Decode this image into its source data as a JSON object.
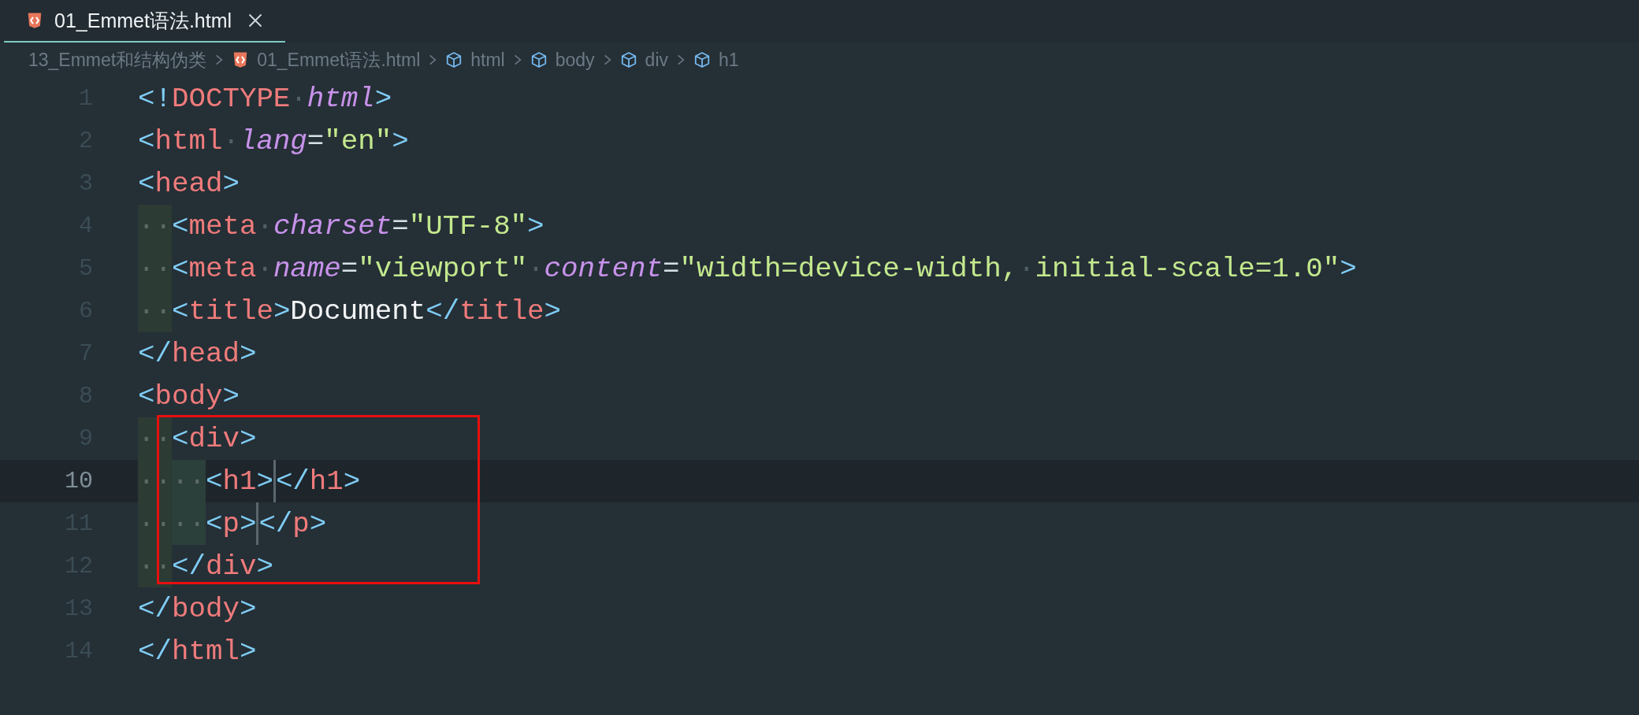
{
  "tab": {
    "label": "01_Emmet语法.html",
    "selected": true
  },
  "breadcrumb": [
    {
      "kind": "folder",
      "label": "13_Emmet和结构伪类"
    },
    {
      "kind": "file",
      "label": "01_Emmet语法.html"
    },
    {
      "kind": "symbol",
      "label": "html"
    },
    {
      "kind": "symbol",
      "label": "body"
    },
    {
      "kind": "symbol",
      "label": "div"
    },
    {
      "kind": "symbol",
      "label": "h1"
    }
  ],
  "lines": [
    {
      "number": "1",
      "current": false,
      "tokens": [
        {
          "kind": "punct",
          "text": "<!"
        },
        {
          "kind": "tag",
          "text": "DOCTYPE"
        },
        {
          "kind": "space",
          "text": "·"
        },
        {
          "kind": "attr",
          "text": "html"
        },
        {
          "kind": "punct",
          "text": ">"
        }
      ]
    },
    {
      "number": "2",
      "current": false,
      "tokens": [
        {
          "kind": "punct",
          "text": "<"
        },
        {
          "kind": "tag",
          "text": "html"
        },
        {
          "kind": "space",
          "text": "·"
        },
        {
          "kind": "attr",
          "text": "lang"
        },
        {
          "kind": "op",
          "text": "="
        },
        {
          "kind": "string",
          "text": "\"en\""
        },
        {
          "kind": "punct",
          "text": ">"
        }
      ]
    },
    {
      "number": "3",
      "current": false,
      "tokens": [
        {
          "kind": "punct",
          "text": "<"
        },
        {
          "kind": "tag",
          "text": "head"
        },
        {
          "kind": "punct",
          "text": ">"
        }
      ]
    },
    {
      "number": "4",
      "current": false,
      "tokens": [
        {
          "kind": "indent",
          "text": "··"
        },
        {
          "kind": "punct",
          "text": "<"
        },
        {
          "kind": "tag",
          "text": "meta"
        },
        {
          "kind": "space",
          "text": "·"
        },
        {
          "kind": "attr",
          "text": "charset"
        },
        {
          "kind": "op",
          "text": "="
        },
        {
          "kind": "string",
          "text": "\"UTF-8\""
        },
        {
          "kind": "punct",
          "text": ">"
        }
      ]
    },
    {
      "number": "5",
      "current": false,
      "tokens": [
        {
          "kind": "indent",
          "text": "··"
        },
        {
          "kind": "punct",
          "text": "<"
        },
        {
          "kind": "tag",
          "text": "meta"
        },
        {
          "kind": "space",
          "text": "·"
        },
        {
          "kind": "attr",
          "text": "name"
        },
        {
          "kind": "op",
          "text": "="
        },
        {
          "kind": "string",
          "text": "\"viewport\""
        },
        {
          "kind": "space",
          "text": "·"
        },
        {
          "kind": "attr",
          "text": "content"
        },
        {
          "kind": "op",
          "text": "="
        },
        {
          "kind": "string",
          "text": "\"width=device-width,"
        },
        {
          "kind": "space",
          "text": "·"
        },
        {
          "kind": "string",
          "text": "initial-scale=1.0\""
        },
        {
          "kind": "punct",
          "text": ">"
        }
      ]
    },
    {
      "number": "6",
      "current": false,
      "tokens": [
        {
          "kind": "indent",
          "text": "··"
        },
        {
          "kind": "punct",
          "text": "<"
        },
        {
          "kind": "tag",
          "text": "title"
        },
        {
          "kind": "punct",
          "text": ">"
        },
        {
          "kind": "text",
          "text": "Document"
        },
        {
          "kind": "punct",
          "text": "</"
        },
        {
          "kind": "tag",
          "text": "title"
        },
        {
          "kind": "punct",
          "text": ">"
        }
      ]
    },
    {
      "number": "7",
      "current": false,
      "tokens": [
        {
          "kind": "punct",
          "text": "</"
        },
        {
          "kind": "tag",
          "text": "head"
        },
        {
          "kind": "punct",
          "text": ">"
        }
      ]
    },
    {
      "number": "8",
      "current": false,
      "tokens": [
        {
          "kind": "punct",
          "text": "<"
        },
        {
          "kind": "tag",
          "text": "body"
        },
        {
          "kind": "punct",
          "text": ">"
        }
      ]
    },
    {
      "number": "9",
      "current": false,
      "tokens": [
        {
          "kind": "indent",
          "text": "··"
        },
        {
          "kind": "punct",
          "text": "<"
        },
        {
          "kind": "tag",
          "text": "div"
        },
        {
          "kind": "punct",
          "text": ">"
        }
      ]
    },
    {
      "number": "10",
      "current": true,
      "tokens": [
        {
          "kind": "indent",
          "text": "··"
        },
        {
          "kind": "indent2",
          "text": "··"
        },
        {
          "kind": "punct",
          "text": "<"
        },
        {
          "kind": "tag",
          "text": "h1"
        },
        {
          "kind": "punct",
          "text": ">"
        },
        {
          "kind": "cursor"
        },
        {
          "kind": "punct",
          "text": "</"
        },
        {
          "kind": "tag",
          "text": "h1"
        },
        {
          "kind": "punct",
          "text": ">"
        }
      ]
    },
    {
      "number": "11",
      "current": false,
      "tokens": [
        {
          "kind": "indent",
          "text": "··"
        },
        {
          "kind": "indent2",
          "text": "··"
        },
        {
          "kind": "punct",
          "text": "<"
        },
        {
          "kind": "tag",
          "text": "p"
        },
        {
          "kind": "punct",
          "text": ">"
        },
        {
          "kind": "cursor"
        },
        {
          "kind": "punct",
          "text": "</"
        },
        {
          "kind": "tag",
          "text": "p"
        },
        {
          "kind": "punct",
          "text": ">"
        }
      ]
    },
    {
      "number": "12",
      "current": false,
      "tokens": [
        {
          "kind": "indent",
          "text": "··"
        },
        {
          "kind": "punct",
          "text": "</"
        },
        {
          "kind": "tag",
          "text": "div"
        },
        {
          "kind": "punct",
          "text": ">"
        }
      ]
    },
    {
      "number": "13",
      "current": false,
      "tokens": [
        {
          "kind": "punct",
          "text": "</"
        },
        {
          "kind": "tag",
          "text": "body"
        },
        {
          "kind": "punct",
          "text": ">"
        }
      ]
    },
    {
      "number": "14",
      "current": false,
      "tokens": [
        {
          "kind": "punct",
          "text": "</"
        },
        {
          "kind": "tag",
          "text": "html"
        },
        {
          "kind": "punct",
          "text": ">"
        }
      ]
    }
  ],
  "annotation": {
    "kind": "rectangle"
  }
}
